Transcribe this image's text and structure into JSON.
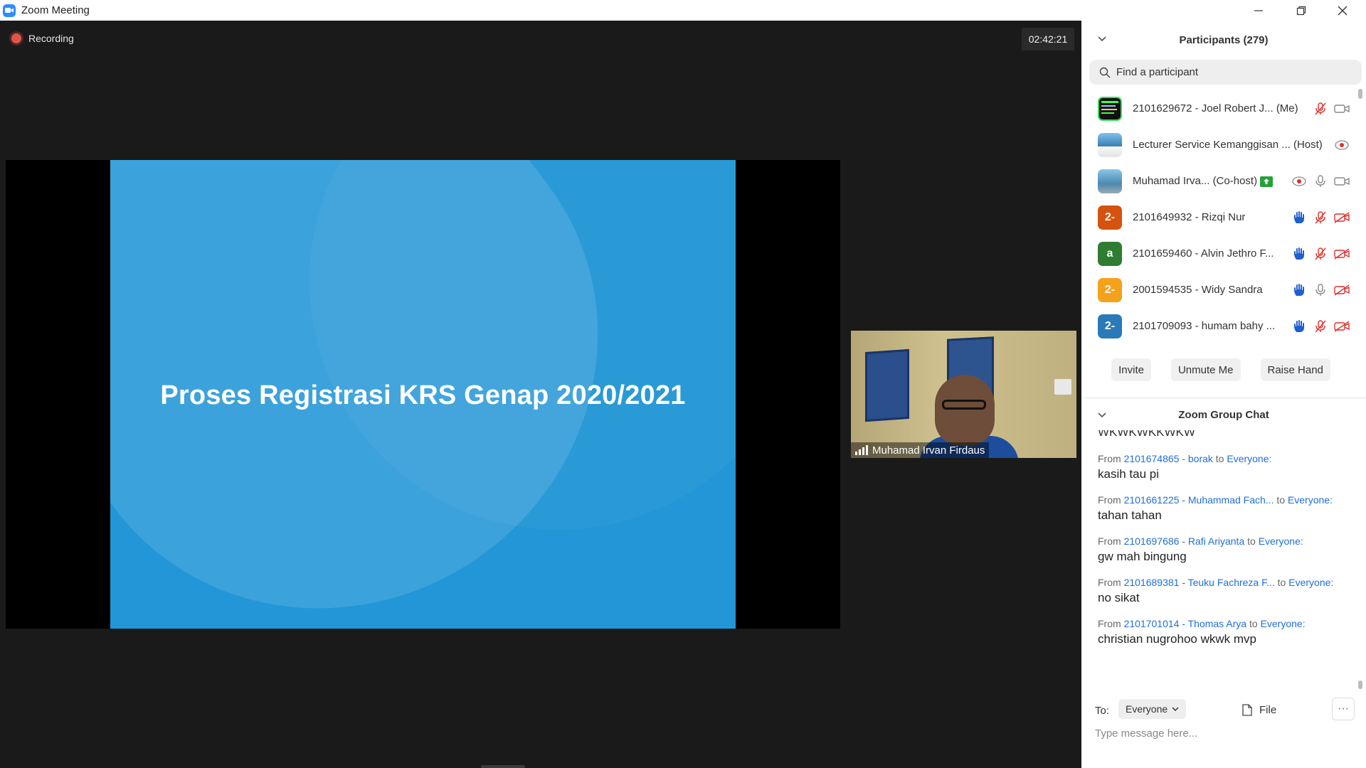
{
  "window": {
    "title": "Zoom Meeting"
  },
  "main": {
    "recording_label": "Recording",
    "timer": "02:42:21",
    "slide_title": "Proses Registrasi KRS Genap 2020/2021",
    "camera_name": "Muhamad Irvan Firdaus",
    "colors": {
      "slide_bg": "#2296d6",
      "recording_red": "#e0554a"
    }
  },
  "participants": {
    "title": "Participants (279)",
    "search_placeholder": "Find a participant",
    "items": [
      {
        "name": "2101629672 - Joel Robert J...",
        "tag": "(Me)",
        "avatar": "img1",
        "icons": [
          "mic-muted-icon",
          "video-icon"
        ]
      },
      {
        "name": "Lecturer Service Kemanggisan ...",
        "tag": "(Host)",
        "avatar": "img2",
        "icons": [
          "recording-icon"
        ]
      },
      {
        "name": "Muhamad Irva...",
        "tag": "(Co-host)",
        "avatar": "img3",
        "icons": [
          "recording-icon",
          "mic-icon",
          "video-icon"
        ],
        "sharing": true
      },
      {
        "name": "2101649932 - Rizqi Nur",
        "tag": "",
        "avatar_text": "2-",
        "avatar_color": "#d4530f",
        "icons": [
          "raise-hand-icon",
          "mic-muted-icon",
          "video-off-icon"
        ]
      },
      {
        "name": "2101659460 - Alvin Jethro F...",
        "tag": "",
        "avatar_text": "a",
        "avatar_color": "#2e7d32",
        "icons": [
          "raise-hand-icon",
          "mic-muted-icon",
          "video-off-icon"
        ]
      },
      {
        "name": "2001594535 - Widy Sandra",
        "tag": "",
        "avatar_text": "2-",
        "avatar_color": "#f5a21b",
        "icons": [
          "raise-hand-icon",
          "mic-icon",
          "video-off-icon"
        ]
      },
      {
        "name": "2101709093 - humam bahy ...",
        "tag": "",
        "avatar_text": "2-",
        "avatar_color": "#2a7ab8",
        "icons": [
          "raise-hand-icon",
          "mic-muted-icon",
          "video-off-icon"
        ]
      }
    ],
    "buttons": {
      "invite": "Invite",
      "unmute": "Unmute Me",
      "raise_hand": "Raise Hand"
    }
  },
  "chat": {
    "title": "Zoom Group Chat",
    "partial_top": "WKWKWKKWKW",
    "from_label": "From",
    "to_label": "to",
    "messages": [
      {
        "from": "2101674865 - borak",
        "to": "Everyone:",
        "text": "kasih tau pi"
      },
      {
        "from": "2101661225 - Muhammad Fach...",
        "to": "Everyone:",
        "text": "tahan tahan"
      },
      {
        "from": "2101697686 - Rafi Ariyanta",
        "to": "Everyone:",
        "text": "gw mah bingung"
      },
      {
        "from": "2101689381 - Teuku Fachreza F...",
        "to": "Everyone:",
        "text": "no sikat"
      },
      {
        "from": "2101701014 - Thomas Arya",
        "to": "Everyone:",
        "text": "christian nugrohoo wkwk mvp"
      }
    ],
    "compose": {
      "to_label": "To:",
      "recipient": "Everyone",
      "file_label": "File",
      "more_label": "···",
      "placeholder": "Type message here..."
    }
  }
}
